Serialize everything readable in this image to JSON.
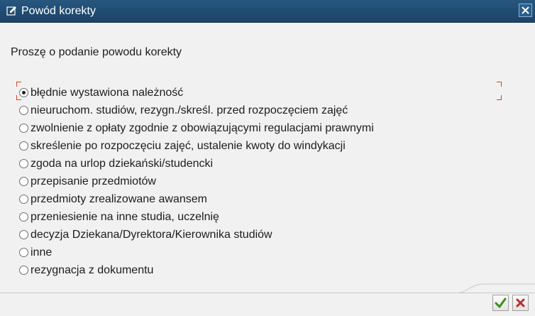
{
  "window": {
    "title": "Powód korekty",
    "title_icon": "edit-window-icon",
    "close_icon": "close-icon"
  },
  "prompt": "Proszę o podanie powodu korekty",
  "options": [
    {
      "label": "błędnie wystawiona należność",
      "checked": true
    },
    {
      "label": "nieuruchom. studiów, rezygn./skreśl. przed rozpoczęciem zajęć",
      "checked": false
    },
    {
      "label": "zwolnienie z opłaty zgodnie z obowiązującymi regulacjami prawnymi",
      "checked": false
    },
    {
      "label": "skreślenie po rozpoczęciu zajęć, ustalenie kwoty do windykacji",
      "checked": false
    },
    {
      "label": "zgoda na urlop dziekański/studencki",
      "checked": false
    },
    {
      "label": "przepisanie przedmiotów",
      "checked": false
    },
    {
      "label": "przedmioty zrealizowane awansem",
      "checked": false
    },
    {
      "label": "przeniesienie na inne studia, uczelnię",
      "checked": false
    },
    {
      "label": "decyzja Dziekana/Dyrektora/Kierownika studiów",
      "checked": false
    },
    {
      "label": "inne",
      "checked": false
    },
    {
      "label": "rezygnacja z dokumentu",
      "checked": false
    }
  ],
  "footer": {
    "ok_icon": "checkmark-icon",
    "cancel_icon": "cancel-x-icon"
  },
  "colors": {
    "titlebar": "#1f4a70",
    "focus": "#d84315",
    "ok": "#3a8f1f",
    "cancel": "#c62828"
  }
}
